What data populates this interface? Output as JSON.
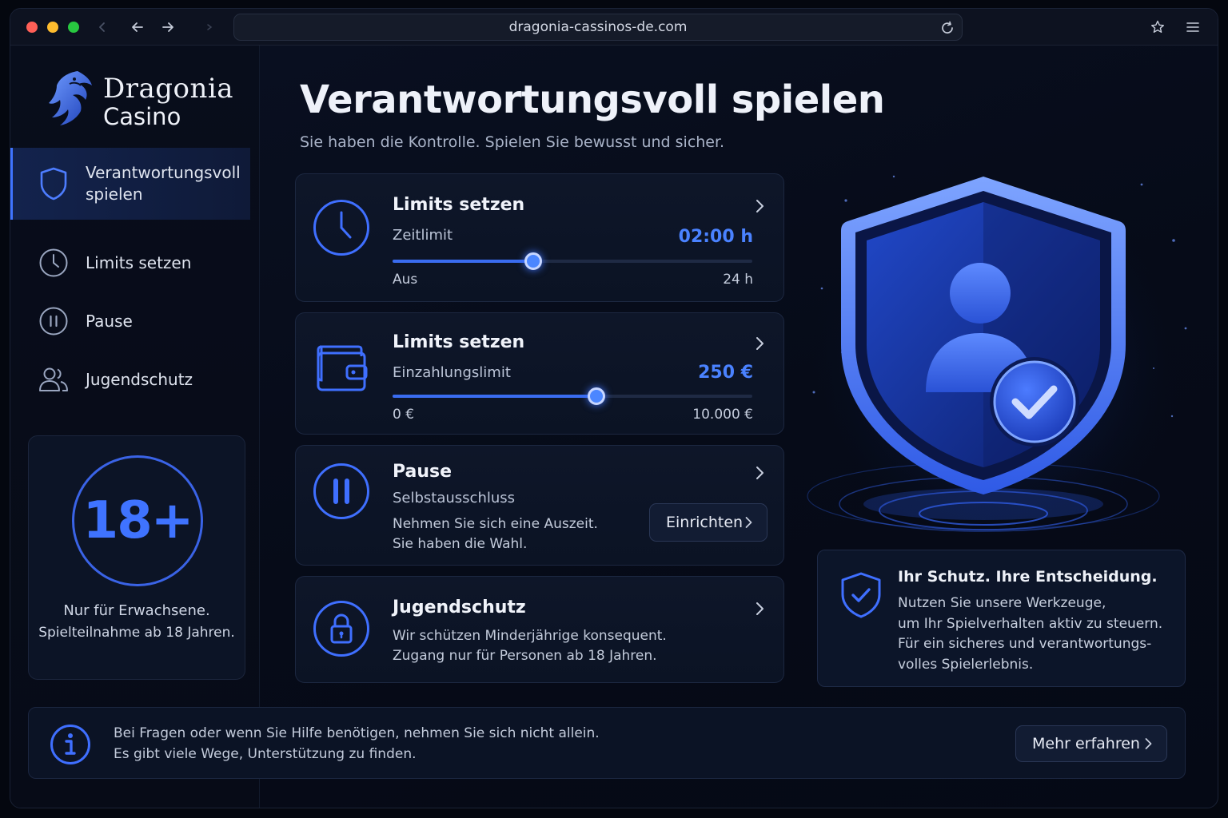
{
  "browser": {
    "url": "dragonia-cassinos-de.com"
  },
  "brand": {
    "line1": "Dragonia",
    "line2": "Casino",
    "accent": "#3f74ff"
  },
  "sidebar": {
    "items": [
      {
        "label": "Verantwortungsvoll spielen",
        "icon": "shield-icon",
        "active": true
      },
      {
        "label": "Limits setzen",
        "icon": "clock-icon",
        "active": false
      },
      {
        "label": "Pause",
        "icon": "pause-icon",
        "active": false
      },
      {
        "label": "Jugendschutz",
        "icon": "users-icon",
        "active": false
      }
    ],
    "age_card": {
      "badge": "18+",
      "line1": "Nur für Erwachsene.",
      "line2": "Spielteilnahme ab 18 Jahren."
    }
  },
  "main": {
    "title": "Verantwortungsvoll spielen",
    "subtitle": "Sie haben die Kontrolle. Spielen Sie bewusst und sicher.",
    "cards": {
      "time_limit": {
        "title": "Limits setzen",
        "subtitle": "Zeitlimit",
        "value": "02:00 h",
        "slider_fraction": 0.39,
        "min_label": "Aus",
        "max_label": "24 h"
      },
      "deposit_limit": {
        "title": "Limits setzen",
        "subtitle": "Einzahlungslimit",
        "value": "250 €",
        "slider_fraction": 0.567,
        "min_label": "0 €",
        "max_label": "10.000 €"
      },
      "pause": {
        "title": "Pause",
        "subtitle": "Selbstausschluss",
        "desc_line1": "Nehmen Sie sich eine Auszeit.",
        "desc_line2": "Sie haben die Wahl.",
        "button": "Einrichten"
      },
      "youth": {
        "title": "Jugendschutz",
        "desc_line1": "Wir schützen Minderjährige konsequent.",
        "desc_line2": "Zugang nur für Personen ab 18 Jahren."
      }
    }
  },
  "info_card": {
    "title": "Ihr Schutz. Ihre Entscheidung.",
    "line1": "Nutzen Sie unsere Werkzeuge,",
    "line2": "um Ihr Spielverhalten aktiv zu steuern.",
    "line3": "Für ein sicheres und verantwortungs-",
    "line4": "volles Spielerlebnis."
  },
  "footer": {
    "line1": "Bei Fragen oder wenn Sie Hilfe benötigen, nehmen Sie sich nicht allein.",
    "line2": "Es gibt viele Wege, Unterstützung zu finden.",
    "button": "Mehr erfahren"
  }
}
